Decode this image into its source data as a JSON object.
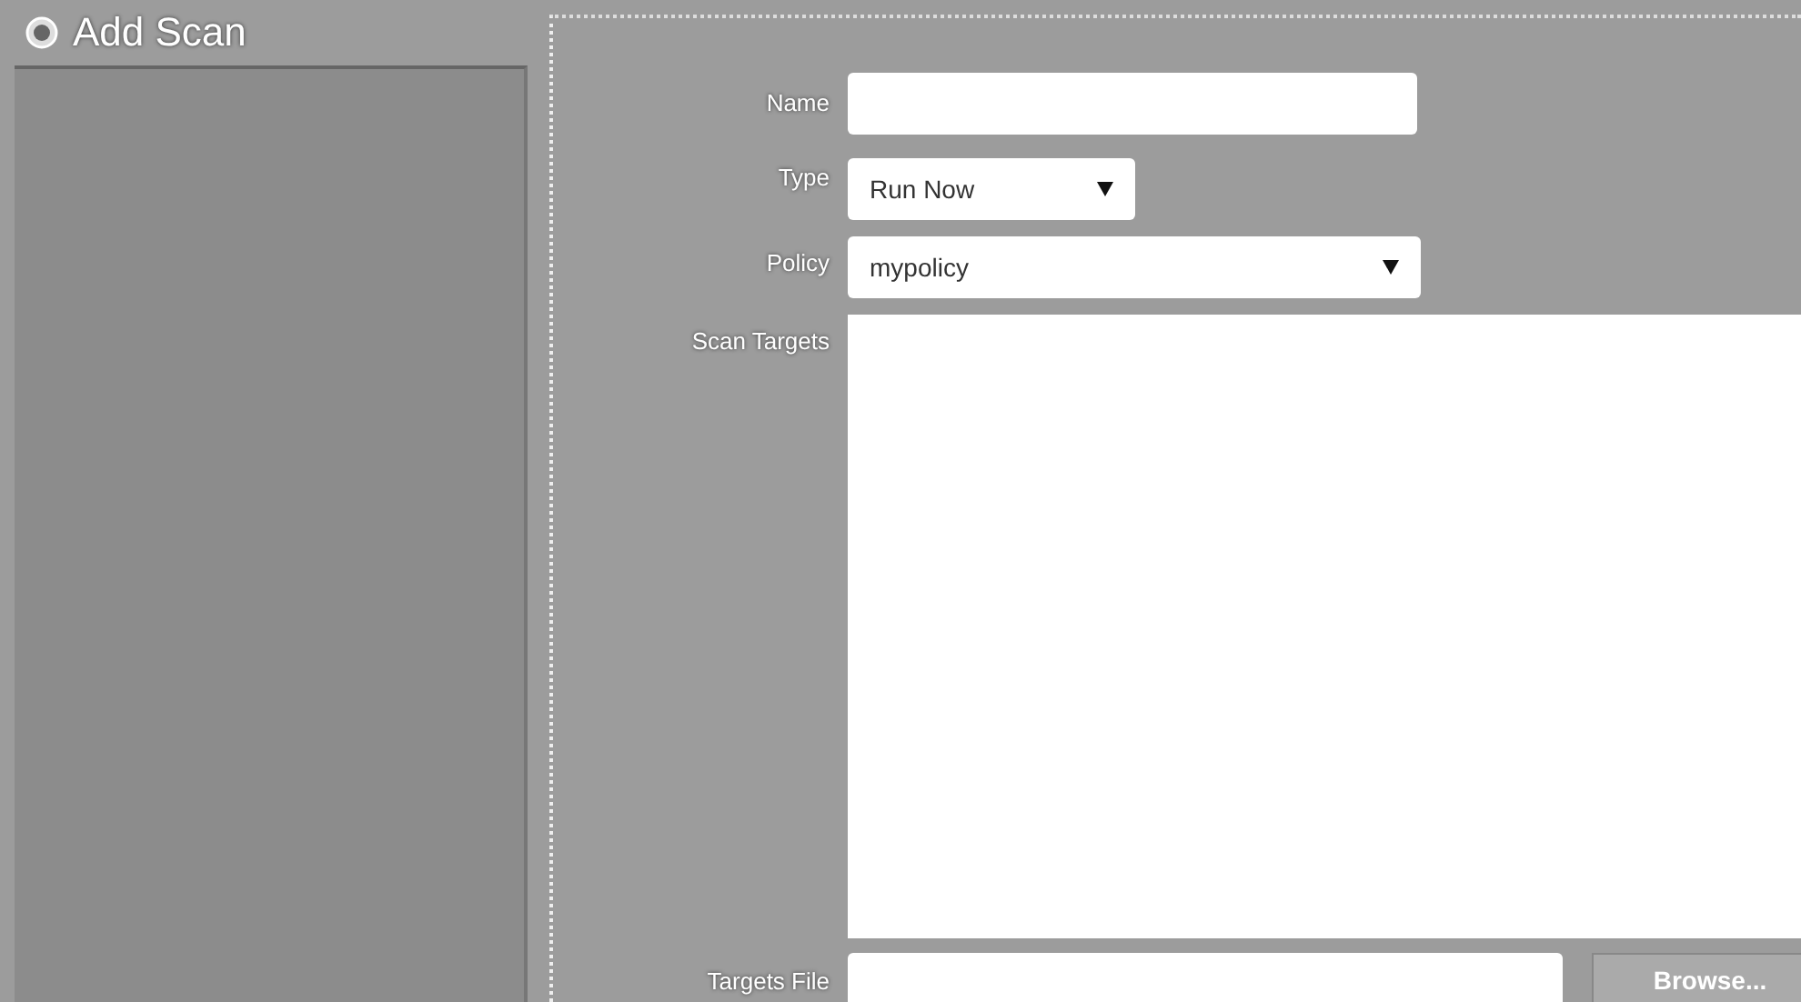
{
  "title": "Add Scan",
  "fields": [
    {
      "label": "Name",
      "kind": "text"
    },
    {
      "label": "Type",
      "kind": "select",
      "value": "Run Now"
    },
    {
      "label": "Policy",
      "kind": "select",
      "value": "mypolicy"
    },
    {
      "label": "Scan Targets",
      "kind": "textarea"
    },
    {
      "label": "Targets File",
      "kind": "file",
      "button": "Browse..."
    }
  ]
}
